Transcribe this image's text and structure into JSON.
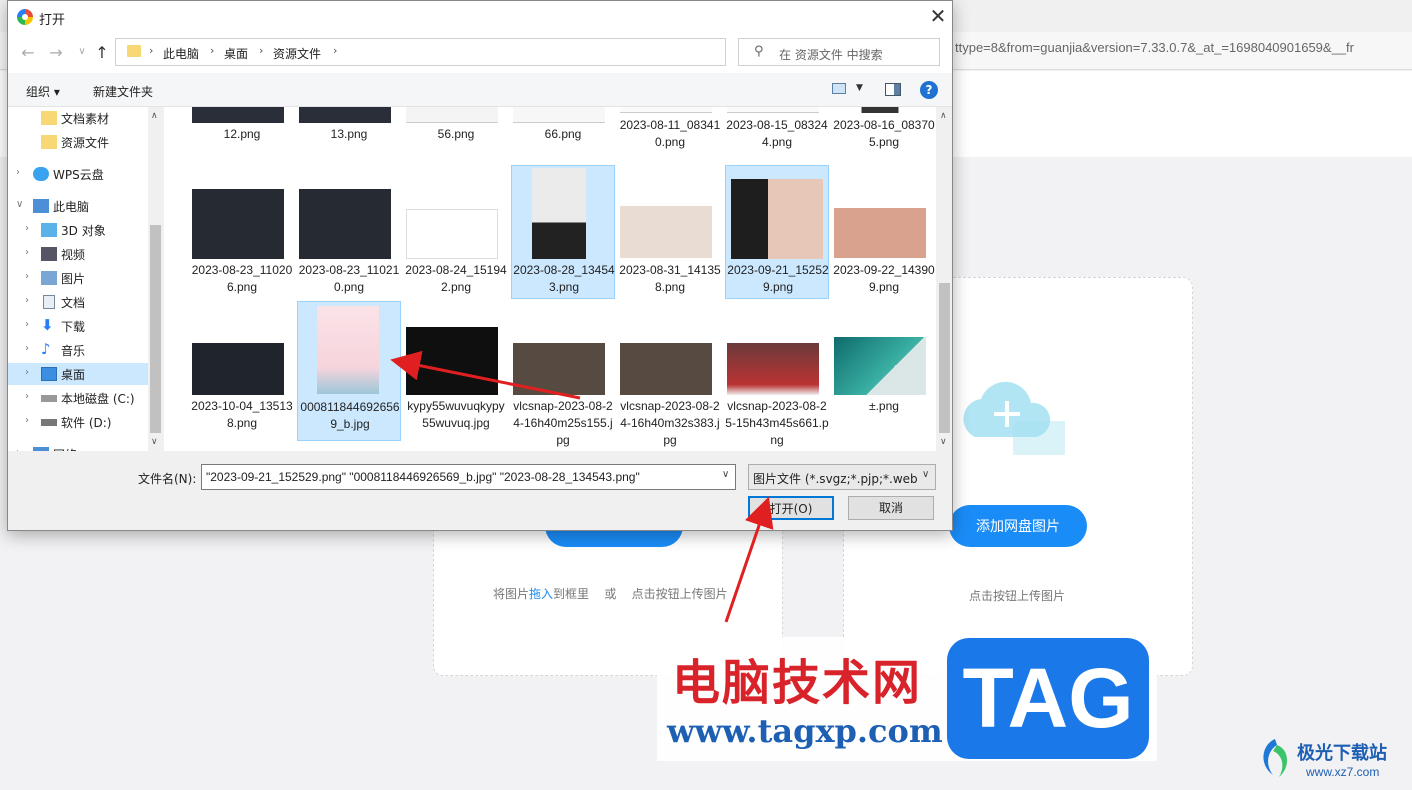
{
  "background": {
    "url_fragment": "ttype=8&from=guanjia&version=7.33.0.7&_at_=1698040901659&__fr",
    "upload_hint_prefix": "将图片",
    "upload_hint_link": "拖入",
    "upload_hint_suffix": "到框里",
    "upload_hint_or": "或",
    "upload_hint_click": "点击按钮上传图片",
    "netdisk_button": "添加网盘图片",
    "netdisk_hint": "点击按钮上传图片"
  },
  "dialog": {
    "title": "打开",
    "breadcrumb": [
      "此电脑",
      "桌面",
      "资源文件"
    ],
    "search_placeholder": "在 资源文件 中搜索",
    "toolbar": {
      "organize": "组织 ▾",
      "new_folder": "新建文件夹"
    },
    "nav": [
      {
        "label": "文档素材",
        "icon": "folder-icon"
      },
      {
        "label": "资源文件",
        "icon": "folder-icon"
      },
      {
        "label": "WPS云盘",
        "icon": "cloud-icon"
      },
      {
        "label": "此电脑",
        "icon": "computer-icon"
      },
      {
        "label": "3D 对象",
        "icon": "3d-objects-icon"
      },
      {
        "label": "视频",
        "icon": "video-icon"
      },
      {
        "label": "图片",
        "icon": "pictures-icon"
      },
      {
        "label": "文档",
        "icon": "documents-icon"
      },
      {
        "label": "下载",
        "icon": "download-icon"
      },
      {
        "label": "音乐",
        "icon": "music-icon"
      },
      {
        "label": "桌面",
        "icon": "desktop-icon"
      },
      {
        "label": "本地磁盘 (C:)",
        "icon": "drive-icon"
      },
      {
        "label": "软件 (D:)",
        "icon": "drive-icon"
      },
      {
        "label": "网络",
        "icon": "network-icon"
      }
    ],
    "files": [
      {
        "name": "12.png",
        "selected": false
      },
      {
        "name": "13.png",
        "selected": false
      },
      {
        "name": "56.png",
        "selected": false
      },
      {
        "name": "66.png",
        "selected": false
      },
      {
        "name": "2023-08-11_083410.png",
        "selected": false
      },
      {
        "name": "2023-08-15_083244.png",
        "selected": false
      },
      {
        "name": "2023-08-16_083705.png",
        "selected": false
      },
      {
        "name": "2023-08-23_110206.png",
        "selected": false
      },
      {
        "name": "2023-08-23_110210.png",
        "selected": false
      },
      {
        "name": "2023-08-24_151942.png",
        "selected": false
      },
      {
        "name": "2023-08-28_134543.png",
        "selected": true
      },
      {
        "name": "2023-08-31_141358.png",
        "selected": false
      },
      {
        "name": "2023-09-21_152529.png",
        "selected": true
      },
      {
        "name": "2023-09-22_143909.png",
        "selected": false
      },
      {
        "name": "2023-10-04_135138.png",
        "selected": false
      },
      {
        "name": "0008118446926569_b.jpg",
        "selected": true
      },
      {
        "name": "kypy55wuvuqkypy55wuvuq.jpg",
        "selected": false
      },
      {
        "name": "vlcsnap-2023-08-24-16h40m25s155.jpg",
        "selected": false
      },
      {
        "name": "vlcsnap-2023-08-24-16h40m32s383.jpg",
        "selected": false
      },
      {
        "name": "vlcsnap-2023-08-25-15h43m45s661.png",
        "selected": false
      },
      {
        "name": "±.png",
        "selected": false
      }
    ],
    "filename_label": "文件名(N):",
    "filename_value": "\"2023-09-21_152529.png\" \"0008118446926569_b.jpg\" \"2023-08-28_134543.png\"",
    "filetype_value": "图片文件 (*.svgz;*.pjp;*.webp;",
    "open_button": "打开(O)",
    "cancel_button": "取消"
  },
  "watermark": {
    "cn_text": "电脑技术网",
    "url": "www.tagxp.com",
    "tag": "TAG",
    "corner_name": "极光下载站",
    "corner_url": "www.xz7.com"
  },
  "colors": {
    "accent": "#1a8cf8",
    "selection": "#cce8ff",
    "annotation": "#e02020"
  }
}
